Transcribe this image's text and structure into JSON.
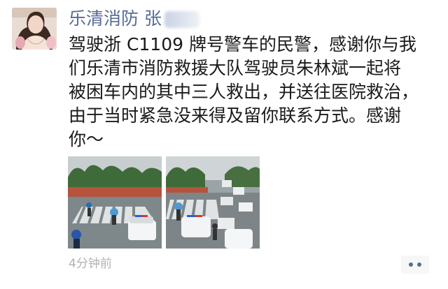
{
  "post": {
    "author": "乐清消防 张",
    "text_lines": [
      "驾驶浙 C1109 牌号警车的民警，感谢你与我",
      "们乐清市消防救援大队驾驶员朱林斌一起将",
      "被困车内的其中三人救出，并送往医院救治，",
      "由于当时紧急没来得及留你联系方式。感谢",
      "你～"
    ],
    "timestamp": "4分钟前",
    "icons": {
      "avatar": "profile-photo",
      "comment": "more-dots-icon"
    }
  }
}
